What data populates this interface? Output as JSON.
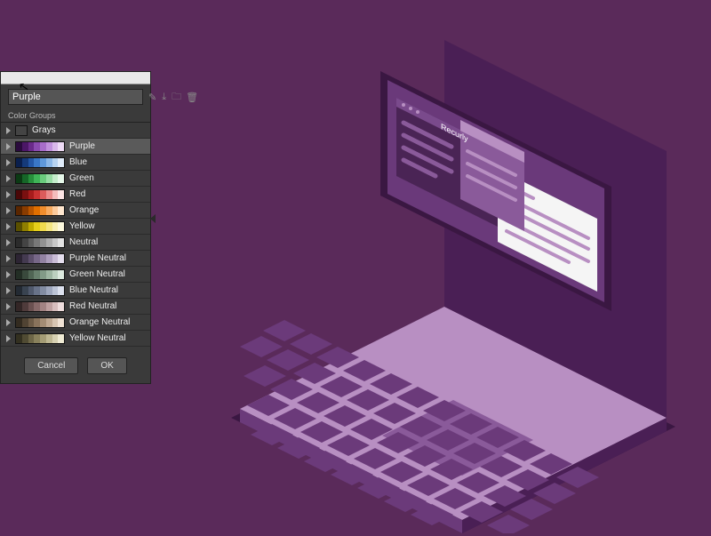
{
  "panel": {
    "input_value": "Purple",
    "section_label": "Color Groups",
    "groups": [
      {
        "name": "Grays",
        "colors": [
          "#222",
          "#333",
          "#444",
          "#666",
          "#888",
          "#aaa",
          "#ccc",
          "#eee"
        ],
        "selected": false,
        "strip": false
      },
      {
        "name": "Purple",
        "colors": [
          "#2a0b3d",
          "#4b1766",
          "#6a2a8a",
          "#8b4bb0",
          "#a86dc9",
          "#c191dc",
          "#d9b8ea",
          "#efdcf6"
        ],
        "selected": true,
        "strip": true
      },
      {
        "name": "Blue",
        "colors": [
          "#0a1f4d",
          "#153a7a",
          "#2457a6",
          "#3a77c7",
          "#5f98da",
          "#8bb7e7",
          "#b7d3f1",
          "#e0ecfa"
        ],
        "selected": false,
        "strip": true
      },
      {
        "name": "Green",
        "colors": [
          "#0b3a14",
          "#166628",
          "#278f3c",
          "#3fb457",
          "#6acb7d",
          "#97dca4",
          "#c4edcb",
          "#e6f8ea"
        ],
        "selected": false,
        "strip": true
      },
      {
        "name": "Red",
        "colors": [
          "#4a0707",
          "#7a1010",
          "#a61c1c",
          "#c83232",
          "#db5b5b",
          "#ea8b8b",
          "#f4bcbc",
          "#fbe4e4"
        ],
        "selected": false,
        "strip": true
      },
      {
        "name": "Orange",
        "colors": [
          "#5a2600",
          "#8a3c00",
          "#b85500",
          "#e06f00",
          "#f08d2d",
          "#f7ab61",
          "#fcca9b",
          "#ffe7cf"
        ],
        "selected": false,
        "strip": true
      },
      {
        "name": "Yellow",
        "colors": [
          "#5a5000",
          "#8f7f00",
          "#c1ab00",
          "#e6cf1a",
          "#f0db4f",
          "#f5e682",
          "#f9f0b4",
          "#fdf9de"
        ],
        "selected": false,
        "strip": true
      },
      {
        "name": "Neutral",
        "colors": [
          "#2b2b2b",
          "#444",
          "#5e5e5e",
          "#787878",
          "#929292",
          "#adadad",
          "#c8c8c8",
          "#e3e3e3"
        ],
        "selected": false,
        "strip": true
      },
      {
        "name": "Purple Neutral",
        "colors": [
          "#2c2433",
          "#443a50",
          "#5d4f6c",
          "#776788",
          "#9282a2",
          "#ad9ebd",
          "#c9bcd6",
          "#e5deee"
        ],
        "selected": false,
        "strip": true
      },
      {
        "name": "Green Neutral",
        "colors": [
          "#232e25",
          "#39493c",
          "#506554",
          "#68806d",
          "#829b87",
          "#9eb6a2",
          "#bcd0bf",
          "#dce9de"
        ],
        "selected": false,
        "strip": true
      },
      {
        "name": "Blue Neutral",
        "colors": [
          "#232a33",
          "#394350",
          "#50596c",
          "#687288",
          "#828ca2",
          "#9ea7bd",
          "#bcc4d6",
          "#dce1ee"
        ],
        "selected": false,
        "strip": true
      },
      {
        "name": "Red Neutral",
        "colors": [
          "#332626",
          "#4f3b3b",
          "#6b5151",
          "#876969",
          "#a28383",
          "#bd9f9f",
          "#d6bdbd",
          "#eedddd"
        ],
        "selected": false,
        "strip": true
      },
      {
        "name": "Orange Neutral",
        "colors": [
          "#332b20",
          "#504333",
          "#6d5b47",
          "#89735c",
          "#a48d75",
          "#bea892",
          "#d7c5b2",
          "#efe2d4"
        ],
        "selected": false,
        "strip": true
      },
      {
        "name": "Yellow Neutral",
        "colors": [
          "#333020",
          "#504b33",
          "#6d6647",
          "#89815c",
          "#a49c75",
          "#beb792",
          "#d7d1b2",
          "#efebd4"
        ],
        "selected": false,
        "strip": true
      }
    ],
    "buttons": {
      "cancel": "Cancel",
      "ok": "OK"
    }
  },
  "illustration": {
    "screen_label": "Recurly",
    "colors": {
      "bg": "#5a2a5a",
      "laptop_light": "#b88fc2",
      "laptop_mid": "#8a5a9a",
      "laptop_dark": "#4a1f55",
      "key": "#6b3a7a",
      "screen_light": "#f5f5f5",
      "screen_purple": "#6a397a"
    }
  }
}
